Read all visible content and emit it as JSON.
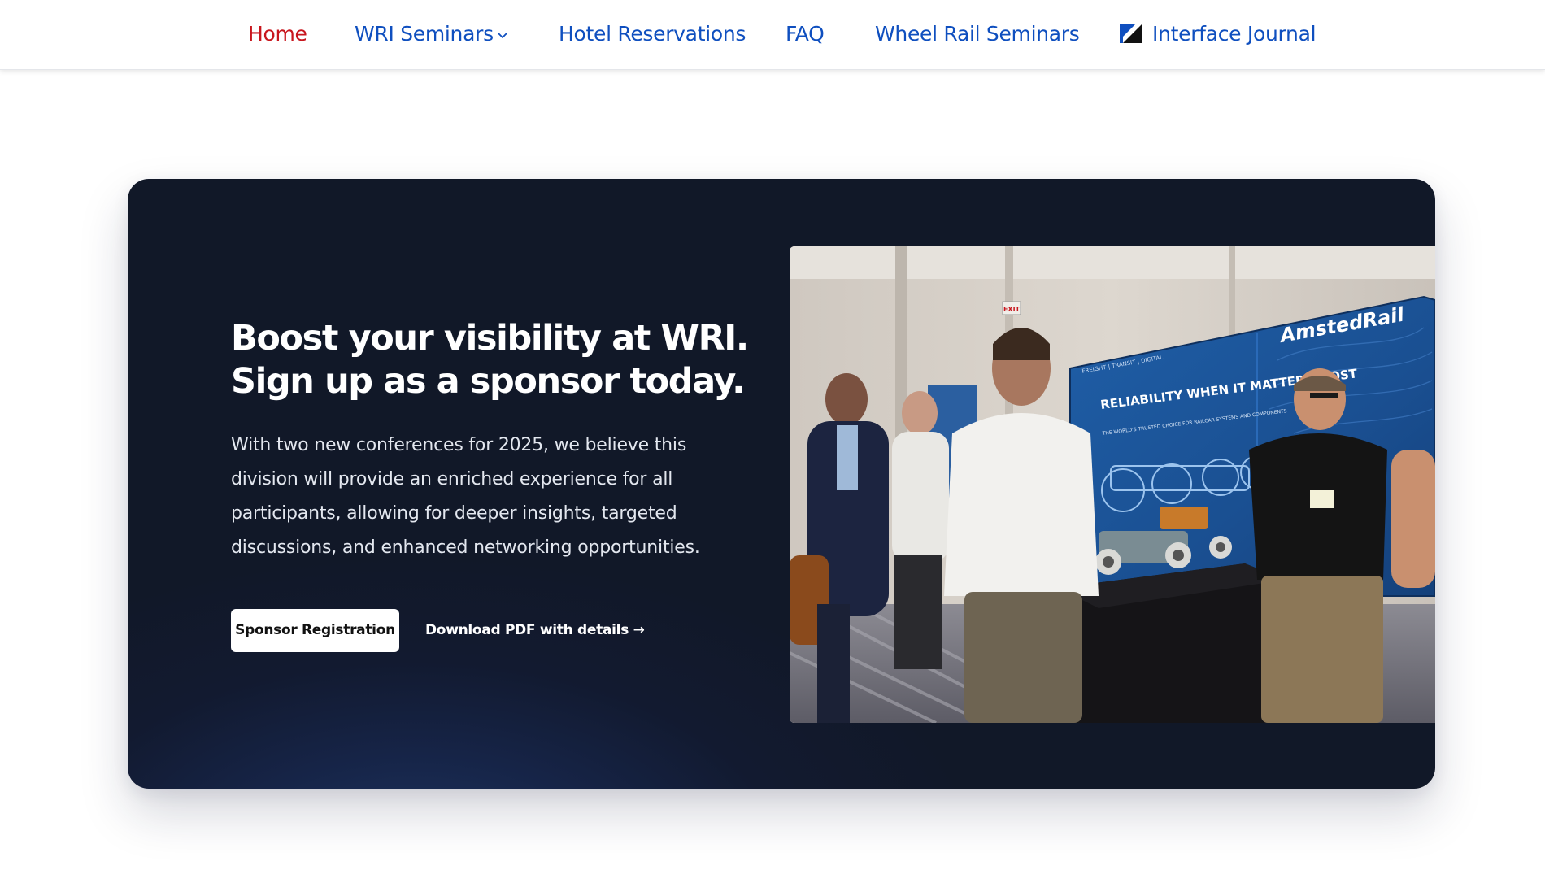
{
  "nav": {
    "items": [
      {
        "label": "Home",
        "active": true
      },
      {
        "label": "WRI Seminars",
        "has_dropdown": true
      },
      {
        "label": "Hotel Reservations"
      },
      {
        "label": "FAQ"
      },
      {
        "label": "Wheel Rail Seminars"
      },
      {
        "label": "Interface Journal",
        "icon": "interface-journal-logo-icon"
      }
    ]
  },
  "hero": {
    "headline_line1": "Boost your visibility at WRI.",
    "headline_line2": "Sign up as a sponsor today.",
    "body": "With two new conferences for 2025, we believe this division will provide an enriched experience for all participants, allowing for deeper insights, targeted discussions, and enhanced networking opportunities.",
    "primary_button": "Sponsor Registration",
    "secondary_link": "Download PDF with details →",
    "photo": {
      "booth_brand": "AmstedRail",
      "booth_tagline": "RELIABILITY WHEN IT MATTERS MOST",
      "booth_subtext": "THE WORLD'S TRUSTED CHOICE FOR RAILCAR SYSTEMS AND COMPONENTS",
      "booth_topline": "FREIGHT | TRANSIT | DIGITAL",
      "exit_sign": "EXIT"
    }
  },
  "colors": {
    "nav_link": "#0f4fbf",
    "nav_active": "#c8161d",
    "hero_bg": "#121a30",
    "button_bg": "#ffffff"
  }
}
